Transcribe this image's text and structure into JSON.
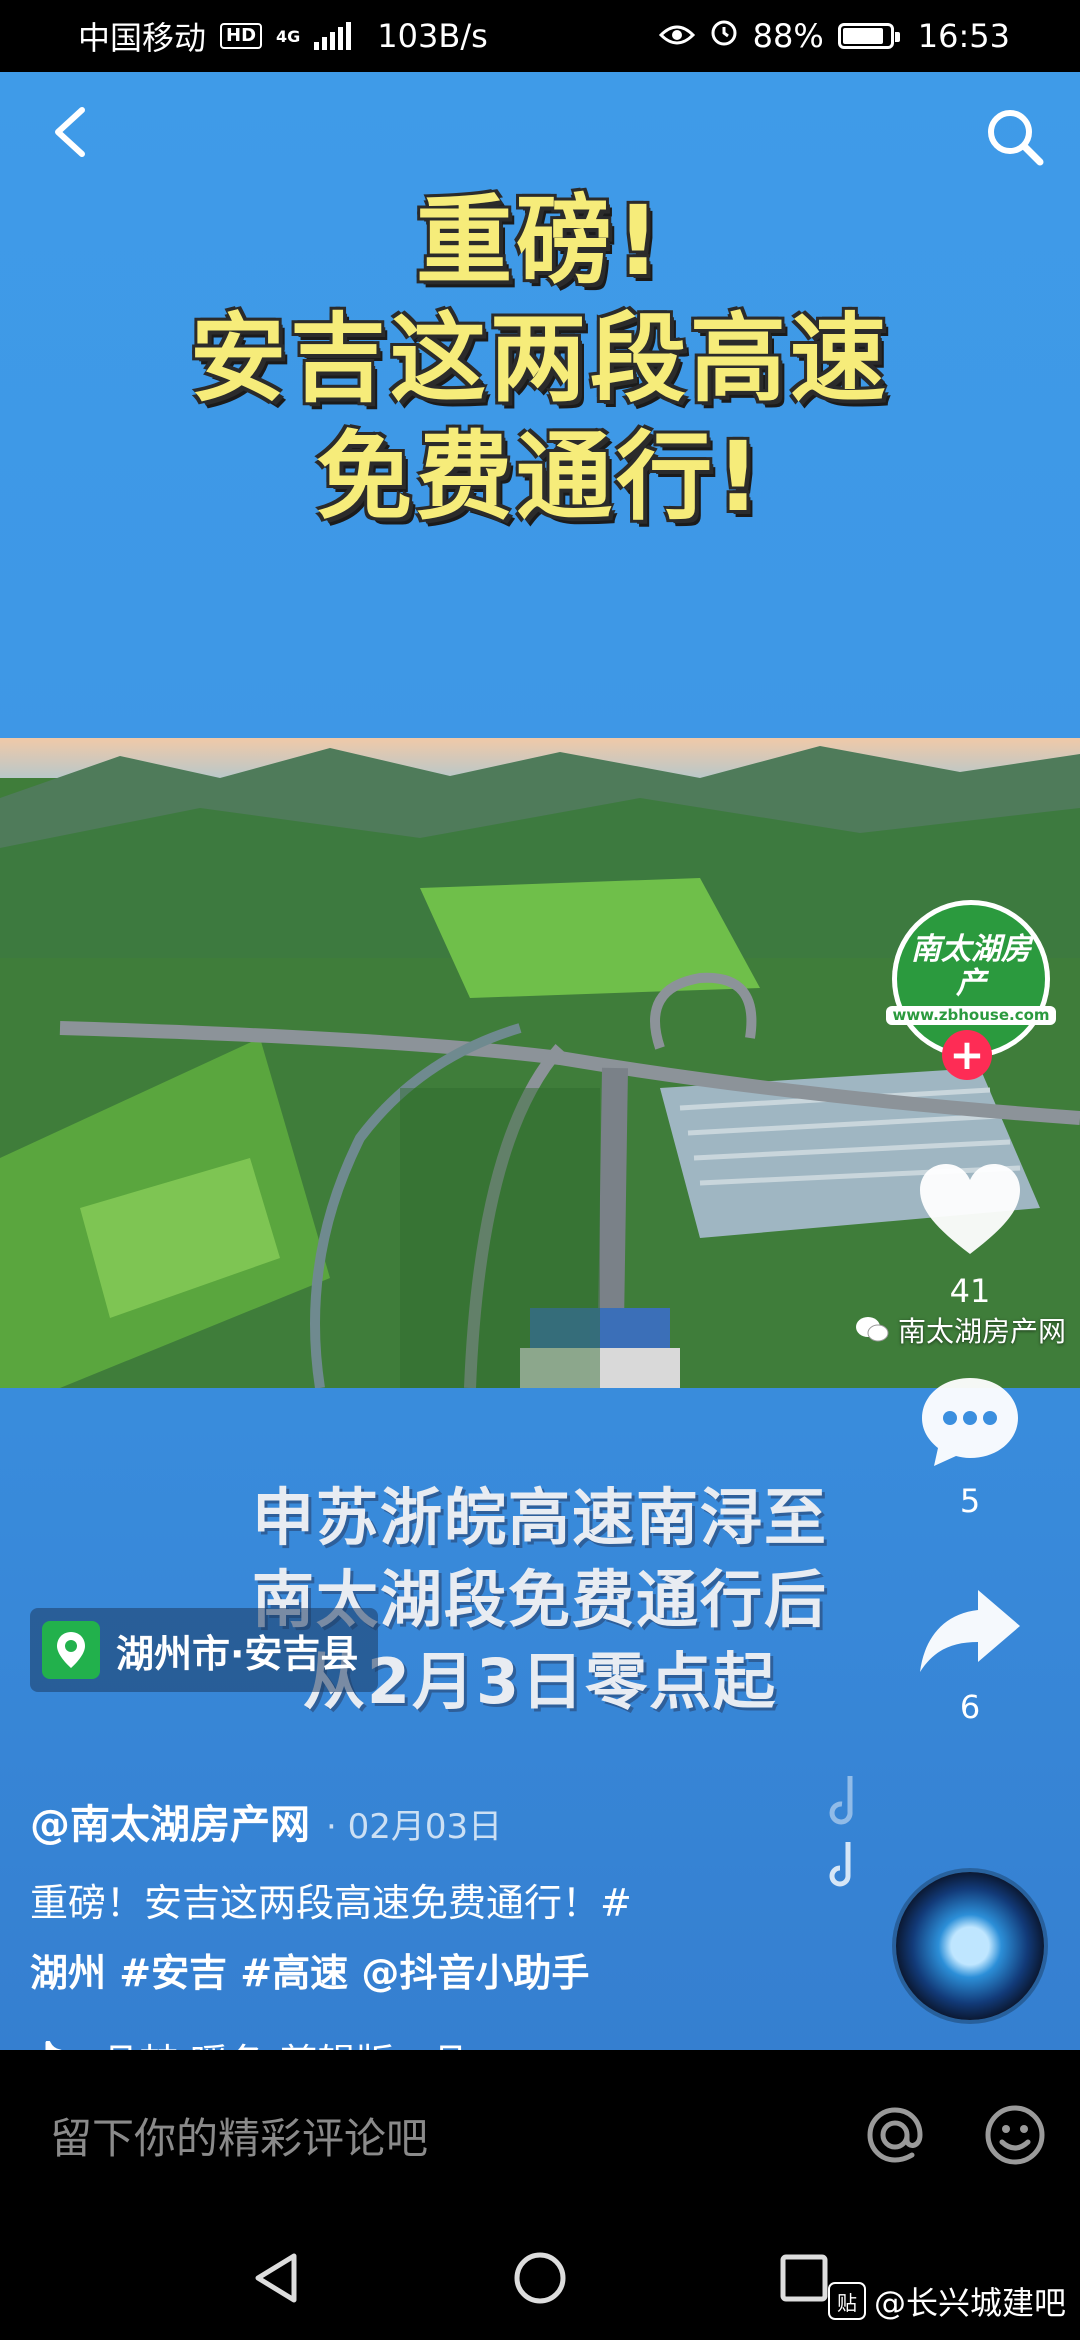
{
  "status_bar": {
    "carrier": "中国移动",
    "hd": "HD",
    "network": "4G",
    "speed": "103B/s",
    "battery": "88%",
    "battery_level": 0.88,
    "time": "16:53"
  },
  "video": {
    "headline": [
      "重磅!",
      "安吉这两段高速",
      "免费通行!"
    ],
    "photo_watermark": "南太湖房产网",
    "subtitle": [
      "申苏浙皖高速南浔至",
      "南太湖段免费通行后",
      "从2月3日零点起"
    ]
  },
  "avatar": {
    "brand": "南太湖房产",
    "url": "www.zbhouse.com"
  },
  "actions": {
    "likes": "41",
    "comments": "5",
    "shares": "6"
  },
  "post": {
    "location": "湖州市·安吉县",
    "author": "@南太湖房产网",
    "date": "· 02月03日",
    "description": "重磅！安吉这两段高速免费通行！#",
    "tags": "湖州 #安吉 #高速 @抖音小助手",
    "music": "- 品喆    暖冬-剪辑版 - 品"
  },
  "comment_bar": {
    "placeholder": "留下你的精彩评论吧"
  },
  "corner_watermark": {
    "badge": "贴",
    "text": "@长兴城建吧"
  },
  "colors": {
    "video_bg": "#3e97e6",
    "headline_yellow": "#f6ec7a",
    "follow_red": "#fe2c55",
    "location_green": "#22b14c"
  }
}
